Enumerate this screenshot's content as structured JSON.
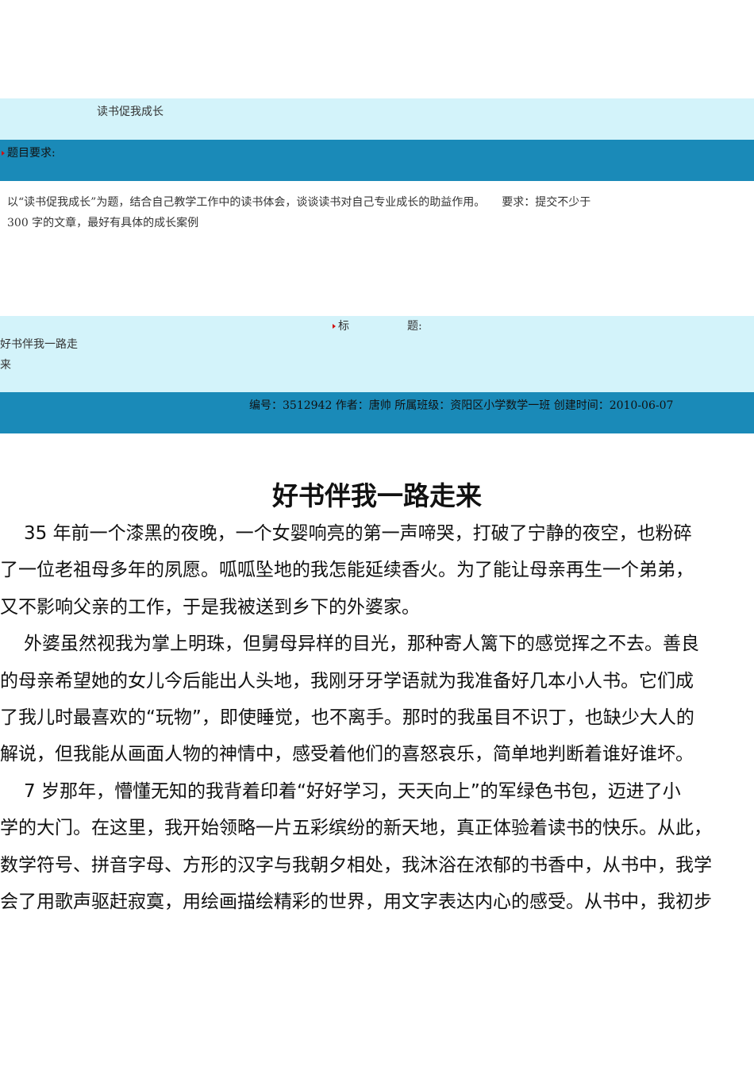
{
  "topic_title": "读书促我成长",
  "requirements_label": "题目要求:",
  "requirements_line1": "以“读书促我成长”为题，结合自己教学工作中的读书体会，谈谈读书对自己专业成长的助益作用。　　要求：提交不少于",
  "requirements_line2": "300 字的文章，最好有具体的成长案例",
  "title_label_a": "标",
  "title_label_b": "题:",
  "title_value_line1": "好书伴我一路走",
  "title_value_line2": "来",
  "meta": "编号：3512942 作者：唐帅 所属班级：资阳区小学数学一班 创建时间：2010-06-07",
  "article": {
    "heading": "好书伴我一路走来",
    "lines": [
      "35 年前一个漆黑的夜晚，一个女婴响亮的第一声啼哭，打破了宁静的夜空，也粉碎",
      "了一位老祖母多年的夙愿。呱呱坠地的我怎能延续香火。为了能让母亲再生一个弟弟，",
      "又不影响父亲的工作，于是我被送到乡下的外婆家。",
      "外婆虽然视我为掌上明珠，但舅母异样的目光，那种寄人篱下的感觉挥之不去。善良",
      "的母亲希望她的女儿今后能出人头地，我刚牙牙学语就为我准备好几本小人书。它们成",
      "了我儿时最喜欢的“玩物”，即使睡觉，也不离手。那时的我虽目不识丁，也缺少大人的",
      "解说，但我能从画面人物的神情中，感受着他们的喜怒哀乐，简单地判断着谁好谁坏。",
      "7 岁那年，懵懂无知的我背着印着“好好学习，天天向上”的军绿色书包，迈进了小",
      "学的大门。在这里，我开始领略一片五彩缤纷的新天地，真正体验着读书的快乐。从此，",
      "数学符号、拼音字母、方形的汉字与我朝夕相处，我沐浴在浓郁的书香中，从书中，我学",
      "会了用歌声驱赶寂寞，用绘画描绘精彩的世界，用文字表达内心的感受。从书中，我初步"
    ]
  }
}
